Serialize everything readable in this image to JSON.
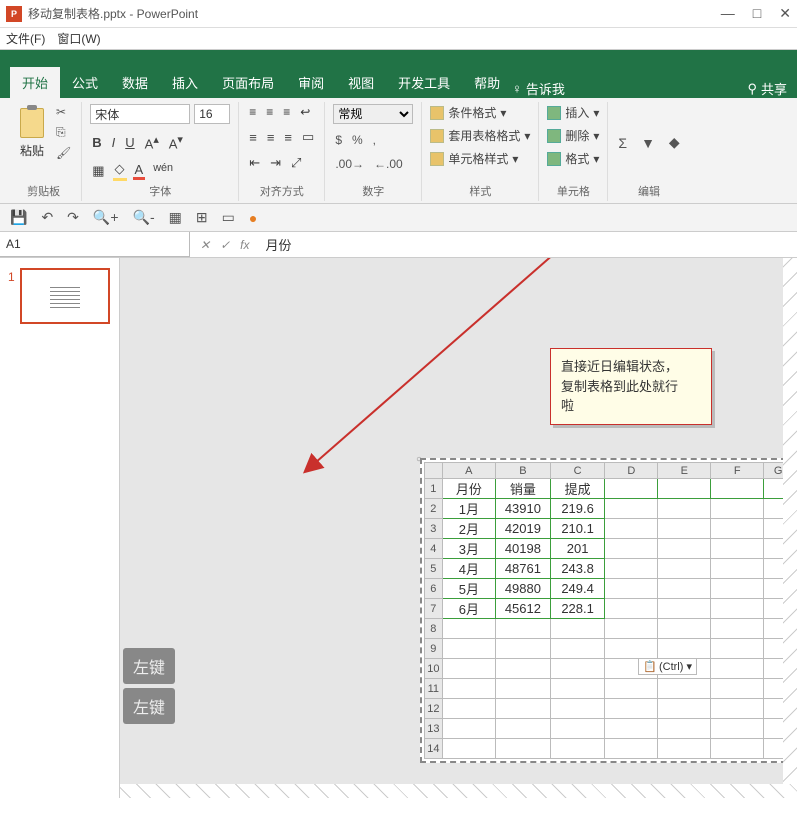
{
  "title": "移动复制表格.pptx - PowerPoint",
  "menubar": {
    "file": "文件(F)",
    "window": "窗口(W)"
  },
  "tabs": {
    "home": "开始",
    "formula": "公式",
    "data": "数据",
    "insert": "插入",
    "layout": "页面布局",
    "review": "审阅",
    "view": "视图",
    "dev": "开发工具",
    "help": "帮助",
    "tellme": "告诉我",
    "share": "共享"
  },
  "ribbon": {
    "clipboard_label": "剪贴板",
    "paste": "粘贴",
    "font_label": "字体",
    "font_name": "宋体",
    "font_size": "16",
    "align_label": "对齐方式",
    "number_label": "数字",
    "number_format": "常规",
    "styles_label": "样式",
    "cond_fmt": "条件格式",
    "tbl_fmt": "套用表格格式",
    "cell_style": "单元格样式",
    "cells_label": "单元格",
    "insert": "插入",
    "delete": "删除",
    "format": "格式",
    "edit_label": "编辑"
  },
  "formula_bar": {
    "cell_ref": "A1",
    "value": "月份"
  },
  "thumb": {
    "num": "1"
  },
  "callout": {
    "line1": "直接近日编辑状态，",
    "line2": "复制表格到此处就行",
    "line3": "啦"
  },
  "sheet": {
    "cols": [
      "A",
      "B",
      "C",
      "D",
      "E",
      "F",
      "G"
    ],
    "headers": [
      "月份",
      "销量",
      "提成"
    ],
    "rows": [
      [
        "1月",
        "43910",
        "219.6"
      ],
      [
        "2月",
        "42019",
        "210.1"
      ],
      [
        "3月",
        "40198",
        "201"
      ],
      [
        "4月",
        "48761",
        "243.8"
      ],
      [
        "5月",
        "49880",
        "249.4"
      ],
      [
        "6月",
        "45612",
        "228.1"
      ]
    ],
    "empty_rows": [
      "8",
      "9",
      "10",
      "11",
      "12",
      "13",
      "14"
    ]
  },
  "smart_tag": "(Ctrl) ▾",
  "leftkey": "左键"
}
